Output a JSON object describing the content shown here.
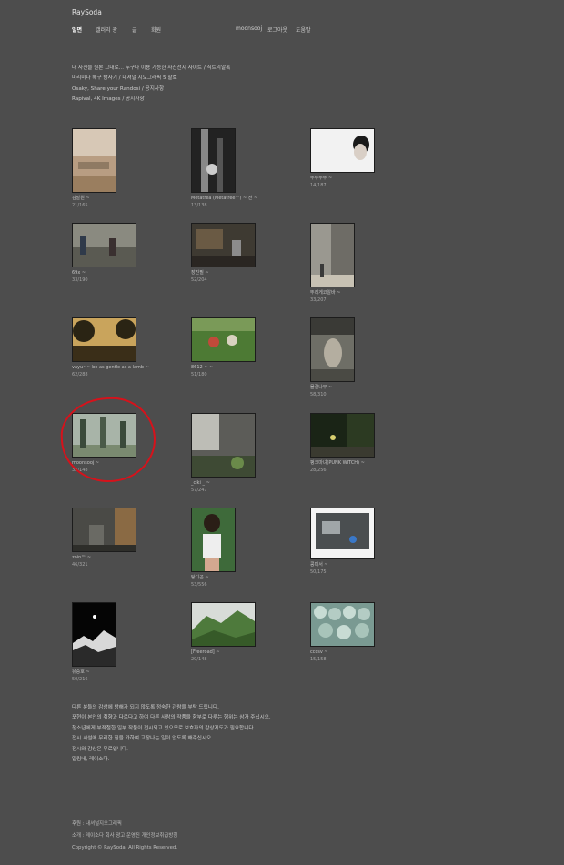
{
  "site": {
    "title": "RaySoda"
  },
  "nav": {
    "items": [
      "일면",
      "갤러리 광",
      "글",
      "회원"
    ],
    "user_items": [
      "moonsooj",
      "로그아웃",
      "도움말"
    ]
  },
  "intro": [
    "내 사진을 원본 그대로... 누구나 이용 가능한 사진전시 사이트 / 직트리알록",
    "미리미나 해구 탐사기 / 내셔널 지오그래픽 5 할호",
    "Osaky, Share your Randosi / 공지사항",
    "Rapival, 4K Images / 공지사항"
  ],
  "gallery": [
    {
      "caption": "김발원 ~",
      "count": "21/165"
    },
    {
      "caption": "Metatrea (Metatree™) ~ 전 ~",
      "count": "13/138"
    },
    {
      "caption": "뚜뚜뚜뚜 ~",
      "count": "14/187"
    },
    {
      "caption": "69x ~",
      "count": "33/190"
    },
    {
      "caption": "장진필 ~",
      "count": "52/204"
    },
    {
      "caption": "뚜리게코알바 ~",
      "count": "33/207"
    },
    {
      "caption": "vayu~~ be as gentle as a lamb ~",
      "count": "62/288"
    },
    {
      "caption": "8612 ~ ~",
      "count": "51/180"
    },
    {
      "caption": "물결나무 ~",
      "count": "58/310"
    },
    {
      "caption": "moonsooj ~",
      "count": "32/148"
    },
    {
      "caption": "_ciki _ ~",
      "count": "57/247"
    },
    {
      "caption": "펑크마녀(PUNK WITCH) ~",
      "count": "28/256"
    },
    {
      "caption": "zoin™ ~",
      "count": "46/321"
    },
    {
      "caption": "탕디곤 ~",
      "count": "53/556"
    },
    {
      "caption": "콩미서 ~",
      "count": "50/175"
    },
    {
      "caption": "유승호 ~",
      "count": "50/216"
    },
    {
      "caption": "[Freeroad] ~",
      "count": "29/148"
    },
    {
      "caption": "cccsv ~",
      "count": "15/158"
    }
  ],
  "notice": [
    "다른 분들의 감상에 방해가 되지 않도록 정숙한 관람을 부탁 드립니다.",
    "포현이 본인의 취향과 다르다고 하여 다른 사람의 작품을 함부로 다루는 행위는 삼가 주십시오.",
    "청소년에게 부적절한 일부 작품이 전시되고 있으므로 보호자의 감상지도가 필요합니다.",
    "전시 시설에 무리한 힘을 가하여 고장나는 일이 없도록 해주십시오.",
    "전시와 감상은 무료입니다.",
    "알림네, 레이소다."
  ],
  "footer": {
    "sponsor": "후원 : 내셔널지오그래픽",
    "links": "소개 : 레이소다  회사  광고  운영진  개인정보취급방침",
    "copyright": "Copyright © RaySoda. All Rights Reserved."
  },
  "colors": {
    "background": "#4d4d4d",
    "highlight": "#d6121b"
  }
}
